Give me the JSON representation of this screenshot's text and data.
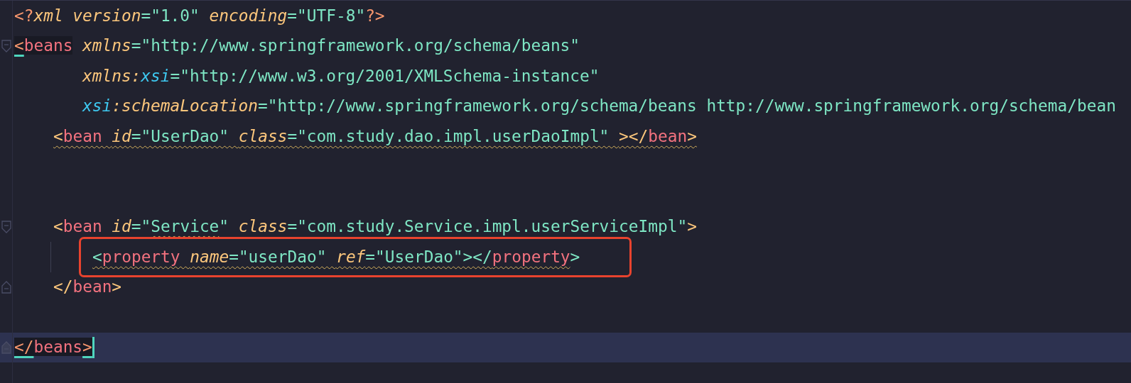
{
  "editor": {
    "lines": [
      {
        "kind": "code",
        "tokens": [
          {
            "kind": "decl",
            "text": "<?"
          },
          {
            "kind": "attr",
            "text": "xml version"
          },
          {
            "kind": "string",
            "text": "=\"1.0\" "
          },
          {
            "kind": "attr",
            "text": "encoding"
          },
          {
            "kind": "string",
            "text": "=\"UTF-8\""
          },
          {
            "kind": "decl",
            "text": "?>"
          }
        ]
      },
      {
        "kind": "code",
        "fold_start": true,
        "tokens": [
          {
            "kind": "decl",
            "text": "<",
            "matched": true
          },
          {
            "kind": "tag",
            "text": "beans",
            "matched": true
          },
          {
            "kind": "attr",
            "text": " xmlns"
          },
          {
            "kind": "string",
            "text": "=\"http://www.springframework.org/schema/beans\""
          }
        ],
        "continuation": [
          {
            "kind": "code",
            "tokens": [
              {
                "kind": "attr",
                "text": "xmlns:"
              },
              {
                "kind": "ns",
                "text": "xsi"
              },
              {
                "kind": "string",
                "text": "=\"http://www.w3.org/2001/XMLSchema-instance\""
              }
            ]
          },
          {
            "kind": "code",
            "tokens": [
              {
                "kind": "ns",
                "text": "xsi"
              },
              {
                "kind": "attr",
                "text": ":schemaLocation"
              },
              {
                "kind": "string",
                "text": "=\"http://www.springframework.org/schema/beans http://www.springframework.org/schema/bean"
              }
            ]
          }
        ],
        "children": [
          {
            "kind": "code",
            "tokens": [
              {
                "kind": "bracket",
                "text": "<",
                "warn": true
              },
              {
                "kind": "tag",
                "text": "bean ",
                "warn": true
              },
              {
                "kind": "attr",
                "text": "id",
                "warn": true
              },
              {
                "kind": "string",
                "text": "=\"UserDao\" ",
                "warn": true
              },
              {
                "kind": "attr",
                "text": "class",
                "warn": true
              },
              {
                "kind": "string",
                "text": "=\"com.study.dao.impl.userDaoImpl\" ",
                "warn": true
              },
              {
                "kind": "bracket",
                "text": "></",
                "warn": true
              },
              {
                "kind": "tag",
                "text": "bean",
                "warn": true
              },
              {
                "kind": "bracket",
                "text": ">",
                "warn": true
              }
            ]
          },
          {
            "kind": "blank"
          },
          {
            "kind": "blank"
          },
          {
            "kind": "code",
            "fold_start": true,
            "tokens": [
              {
                "kind": "bracket",
                "text": "<"
              },
              {
                "kind": "tag",
                "text": "bean "
              },
              {
                "kind": "attr",
                "text": "id"
              },
              {
                "kind": "string",
                "text": "=\""
              },
              {
                "kind": "string",
                "text": "Service",
                "warn": true
              },
              {
                "kind": "string",
                "text": "\" "
              },
              {
                "kind": "attr",
                "text": "class"
              },
              {
                "kind": "string",
                "text": "=\"com.study.Service.impl.userServiceImpl\""
              },
              {
                "kind": "bracket",
                "text": ">"
              }
            ],
            "children": [
              {
                "kind": "code",
                "boxed": true,
                "guide": true,
                "tokens": [
                  {
                    "kind": "string",
                    "text": "<",
                    "warn": true
                  },
                  {
                    "kind": "tag",
                    "text": "property ",
                    "warn": true
                  },
                  {
                    "kind": "attr",
                    "text": "name",
                    "warn": true
                  },
                  {
                    "kind": "string",
                    "text": "=\"userDao\" ",
                    "warn": true
                  },
                  {
                    "kind": "attr",
                    "text": "ref",
                    "warn": true
                  },
                  {
                    "kind": "string",
                    "text": "=\"UserDao\"></",
                    "warn": true
                  },
                  {
                    "kind": "tag",
                    "text": "property",
                    "warn": true
                  },
                  {
                    "kind": "string",
                    "text": ">"
                  }
                ]
              }
            ],
            "closing": {
              "kind": "code",
              "fold_end": true,
              "tokens": [
                {
                  "kind": "bracket",
                  "text": "</"
                },
                {
                  "kind": "tag",
                  "text": "bean"
                },
                {
                  "kind": "bracket",
                  "text": ">"
                }
              ]
            }
          },
          {
            "kind": "blank"
          }
        ],
        "closing": {
          "kind": "code",
          "fold_end": true,
          "current": true,
          "cursor": true,
          "tokens": [
            {
              "kind": "decl",
              "text": "</",
              "matched": true
            },
            {
              "kind": "tag",
              "text": "beans",
              "matched": true
            },
            {
              "kind": "decl",
              "text": ">",
              "matched": true
            }
          ]
        }
      }
    ]
  }
}
